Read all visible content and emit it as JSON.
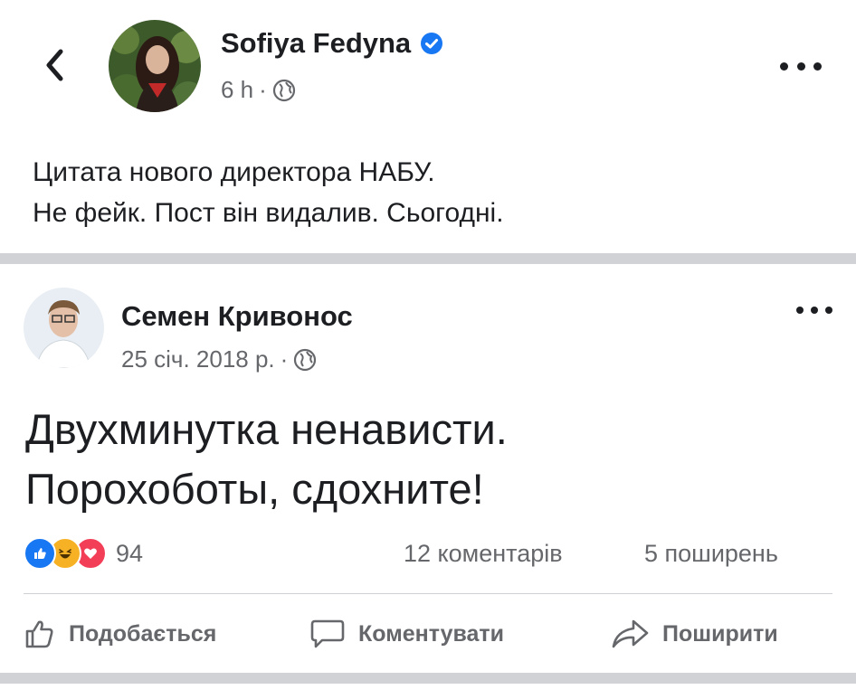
{
  "post": {
    "author": "Sofiya Fedyna",
    "time": "6 h",
    "text_lines": [
      "Цитата нового директора НАБУ.",
      "Не фейк. Пост він видалив. Сьогодні."
    ]
  },
  "shared_post": {
    "author": "Семен Кривонос",
    "date": "25 січ. 2018 р.",
    "text_lines": [
      "Двухминутка ненависти.",
      "Порохоботы, сдохните!"
    ],
    "reactions": {
      "icons": [
        "like-icon",
        "haha-icon",
        "love-icon"
      ],
      "count": "94"
    },
    "comments": "12 коментарів",
    "shares": "5 поширень"
  },
  "actions": {
    "like": "Подобається",
    "comment": "Коментувати",
    "share": "Поширити"
  },
  "colors": {
    "verified": "#1877f2",
    "like": "#1877f2",
    "haha": "#f7b125",
    "love": "#f33e58",
    "secondary_text": "#65676b",
    "divider": "#d0d2d6"
  }
}
